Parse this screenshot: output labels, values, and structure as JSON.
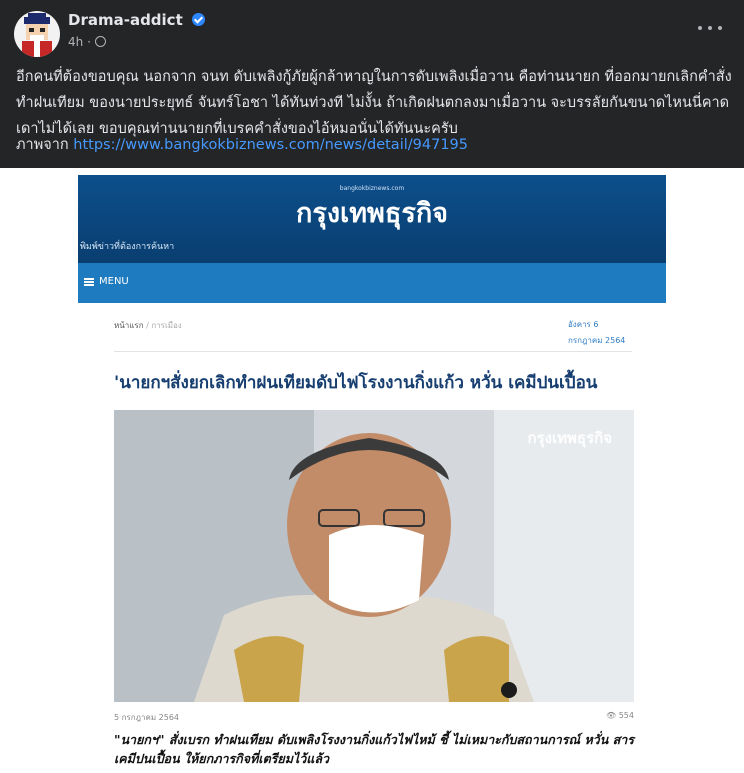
{
  "post": {
    "author": "Drama-addict",
    "time": "4h",
    "text": "อีกคนที่ต้องขอบคุณ นอกจาก จนท ดับเพลิงกู้ภัยผู้กล้าหาญในการดับเพลิงเมื่อวาน คือท่านนายก ที่ออกมายกเลิกคำสั่งทำฝนเทียม ของนายประยุทธ์ จันทร์โอชา ได้ทันท่วงที ไม่งั้น ถ้าเกิดฝนตกลงมาเมื่อวาน จะบรรลัยกันขนาดไหนนี่คาดเดาไม่ได้เลย ขอบคุณท่านนายกที่เบรคคำสั่งของไอ้หมอนั่นได้ทันนะครับ",
    "source_prefix": "ภาพจาก",
    "source_url": "https://www.bangkokbiznews.com/news/detail/947195"
  },
  "article": {
    "site_small": "bangkokbiznews.com",
    "site_logo": "กรุงเทพธุรกิจ",
    "search_text": "พิมพ์ข่าวที่ต้องการค้นหา",
    "menu_label": "MENU",
    "breadcrumb_home": "หน้าแรก",
    "breadcrumb_section": "การเมือง",
    "date_line1": "อังคาร 6",
    "date_line2": "กรกฎาคม 2564",
    "headline": "'นายกฯสั่งยกเลิกทำฝนเทียมดับไฟโรงงานกิ่งแก้ว หวั่น เคมีปนเปื้อน",
    "photo_watermark": "กรุงเทพธุรกิจ",
    "caption_date": "5 กรกฎาคม 2564",
    "views": "554",
    "summary": "\"นายกฯ\" สั่งเบรก ทำฝนเทียม ดับเพลิงโรงงานกิ่งแก้วไฟไหม้ ชี้ ไม่เหมาะกับสถานการณ์ หวั่น สารเคมีปนเปื้อน ให้ยกภารกิจที่เตรียมไว้แล้ว"
  },
  "colors": {
    "background": "#242526",
    "link": "#4599ff",
    "site_header": "#0d4f8c",
    "site_menu": "#1f7bbf",
    "headline": "#163e70"
  }
}
